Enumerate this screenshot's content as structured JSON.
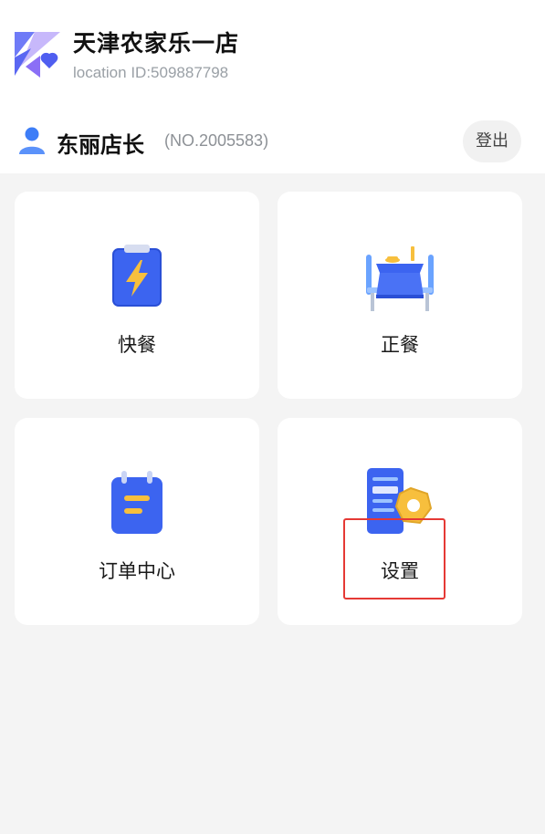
{
  "store": {
    "name": "天津农家乐一店",
    "location_id": "location ID:509887798"
  },
  "user": {
    "name": "东丽店长",
    "number": "(NO.2005583)",
    "logout_label": "登出"
  },
  "menu": [
    {
      "label": "快餐",
      "icon": "lightning-clipboard-icon"
    },
    {
      "label": "正餐",
      "icon": "dining-table-icon"
    },
    {
      "label": "订单中心",
      "icon": "order-list-icon"
    },
    {
      "label": "设置",
      "icon": "settings-phone-gear-icon"
    }
  ],
  "colors": {
    "primary_blue": "#3c64f0",
    "accent_yellow": "#f7bf3d",
    "highlight_red": "#e53935"
  }
}
